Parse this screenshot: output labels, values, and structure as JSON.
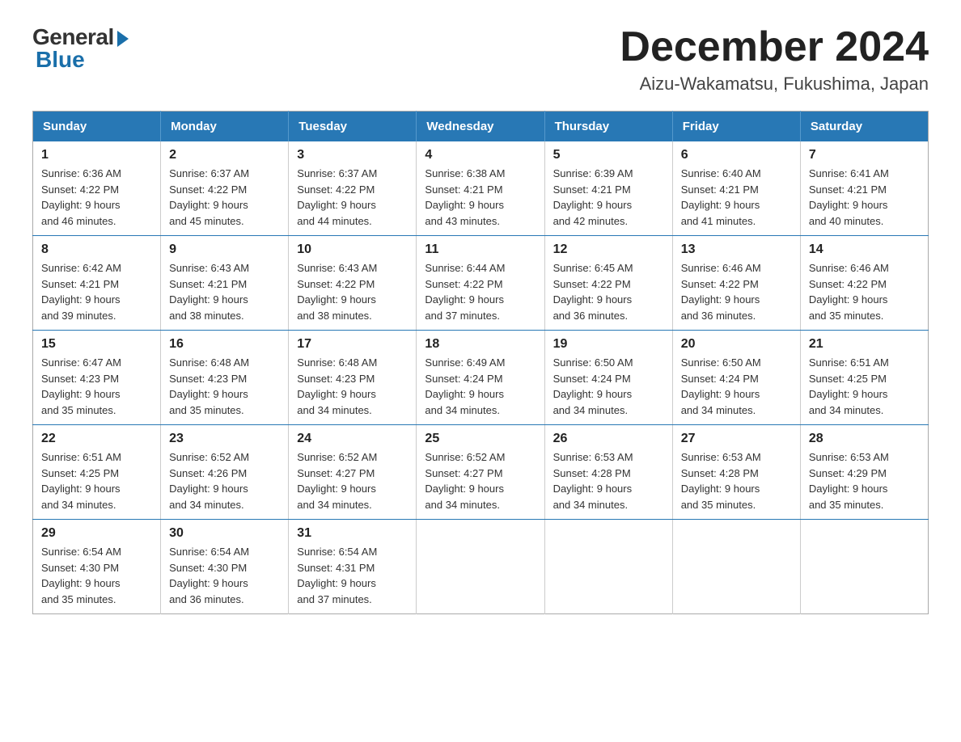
{
  "logo": {
    "general": "General",
    "blue": "Blue"
  },
  "title": {
    "month": "December 2024",
    "location": "Aizu-Wakamatsu, Fukushima, Japan"
  },
  "weekdays": [
    "Sunday",
    "Monday",
    "Tuesday",
    "Wednesday",
    "Thursday",
    "Friday",
    "Saturday"
  ],
  "weeks": [
    [
      {
        "day": "1",
        "sunrise": "6:36 AM",
        "sunset": "4:22 PM",
        "daylight": "9 hours and 46 minutes."
      },
      {
        "day": "2",
        "sunrise": "6:37 AM",
        "sunset": "4:22 PM",
        "daylight": "9 hours and 45 minutes."
      },
      {
        "day": "3",
        "sunrise": "6:37 AM",
        "sunset": "4:22 PM",
        "daylight": "9 hours and 44 minutes."
      },
      {
        "day": "4",
        "sunrise": "6:38 AM",
        "sunset": "4:21 PM",
        "daylight": "9 hours and 43 minutes."
      },
      {
        "day": "5",
        "sunrise": "6:39 AM",
        "sunset": "4:21 PM",
        "daylight": "9 hours and 42 minutes."
      },
      {
        "day": "6",
        "sunrise": "6:40 AM",
        "sunset": "4:21 PM",
        "daylight": "9 hours and 41 minutes."
      },
      {
        "day": "7",
        "sunrise": "6:41 AM",
        "sunset": "4:21 PM",
        "daylight": "9 hours and 40 minutes."
      }
    ],
    [
      {
        "day": "8",
        "sunrise": "6:42 AM",
        "sunset": "4:21 PM",
        "daylight": "9 hours and 39 minutes."
      },
      {
        "day": "9",
        "sunrise": "6:43 AM",
        "sunset": "4:21 PM",
        "daylight": "9 hours and 38 minutes."
      },
      {
        "day": "10",
        "sunrise": "6:43 AM",
        "sunset": "4:22 PM",
        "daylight": "9 hours and 38 minutes."
      },
      {
        "day": "11",
        "sunrise": "6:44 AM",
        "sunset": "4:22 PM",
        "daylight": "9 hours and 37 minutes."
      },
      {
        "day": "12",
        "sunrise": "6:45 AM",
        "sunset": "4:22 PM",
        "daylight": "9 hours and 36 minutes."
      },
      {
        "day": "13",
        "sunrise": "6:46 AM",
        "sunset": "4:22 PM",
        "daylight": "9 hours and 36 minutes."
      },
      {
        "day": "14",
        "sunrise": "6:46 AM",
        "sunset": "4:22 PM",
        "daylight": "9 hours and 35 minutes."
      }
    ],
    [
      {
        "day": "15",
        "sunrise": "6:47 AM",
        "sunset": "4:23 PM",
        "daylight": "9 hours and 35 minutes."
      },
      {
        "day": "16",
        "sunrise": "6:48 AM",
        "sunset": "4:23 PM",
        "daylight": "9 hours and 35 minutes."
      },
      {
        "day": "17",
        "sunrise": "6:48 AM",
        "sunset": "4:23 PM",
        "daylight": "9 hours and 34 minutes."
      },
      {
        "day": "18",
        "sunrise": "6:49 AM",
        "sunset": "4:24 PM",
        "daylight": "9 hours and 34 minutes."
      },
      {
        "day": "19",
        "sunrise": "6:50 AM",
        "sunset": "4:24 PM",
        "daylight": "9 hours and 34 minutes."
      },
      {
        "day": "20",
        "sunrise": "6:50 AM",
        "sunset": "4:24 PM",
        "daylight": "9 hours and 34 minutes."
      },
      {
        "day": "21",
        "sunrise": "6:51 AM",
        "sunset": "4:25 PM",
        "daylight": "9 hours and 34 minutes."
      }
    ],
    [
      {
        "day": "22",
        "sunrise": "6:51 AM",
        "sunset": "4:25 PM",
        "daylight": "9 hours and 34 minutes."
      },
      {
        "day": "23",
        "sunrise": "6:52 AM",
        "sunset": "4:26 PM",
        "daylight": "9 hours and 34 minutes."
      },
      {
        "day": "24",
        "sunrise": "6:52 AM",
        "sunset": "4:27 PM",
        "daylight": "9 hours and 34 minutes."
      },
      {
        "day": "25",
        "sunrise": "6:52 AM",
        "sunset": "4:27 PM",
        "daylight": "9 hours and 34 minutes."
      },
      {
        "day": "26",
        "sunrise": "6:53 AM",
        "sunset": "4:28 PM",
        "daylight": "9 hours and 34 minutes."
      },
      {
        "day": "27",
        "sunrise": "6:53 AM",
        "sunset": "4:28 PM",
        "daylight": "9 hours and 35 minutes."
      },
      {
        "day": "28",
        "sunrise": "6:53 AM",
        "sunset": "4:29 PM",
        "daylight": "9 hours and 35 minutes."
      }
    ],
    [
      {
        "day": "29",
        "sunrise": "6:54 AM",
        "sunset": "4:30 PM",
        "daylight": "9 hours and 35 minutes."
      },
      {
        "day": "30",
        "sunrise": "6:54 AM",
        "sunset": "4:30 PM",
        "daylight": "9 hours and 36 minutes."
      },
      {
        "day": "31",
        "sunrise": "6:54 AM",
        "sunset": "4:31 PM",
        "daylight": "9 hours and 37 minutes."
      },
      null,
      null,
      null,
      null
    ]
  ],
  "labels": {
    "sunrise": "Sunrise:",
    "sunset": "Sunset:",
    "daylight": "Daylight:"
  }
}
